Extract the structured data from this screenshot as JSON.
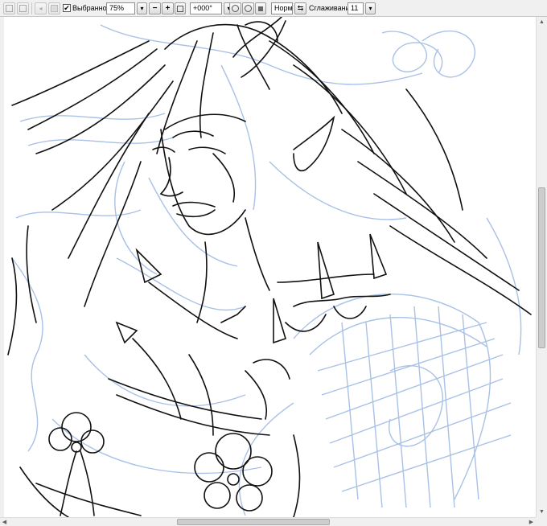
{
  "toolbar": {
    "favorites_checked": true,
    "favorites_label": "Выбранное",
    "zoom_value": "75%",
    "rotation_value": "+000°",
    "blend_mode": "Норм",
    "smoothing_label": "Сглаживание",
    "smoothing_value": "11"
  },
  "icons": {
    "zoom_in": "+",
    "zoom_out": "−",
    "check": "✔",
    "dropdown": "▾",
    "scroll_up": "▲",
    "scroll_down": "▼",
    "scroll_left": "◀",
    "scroll_right": "▶"
  },
  "colors": {
    "sketch_blue": "#a9c1e6",
    "ink": "#111111",
    "canvas": "#ffffff"
  }
}
